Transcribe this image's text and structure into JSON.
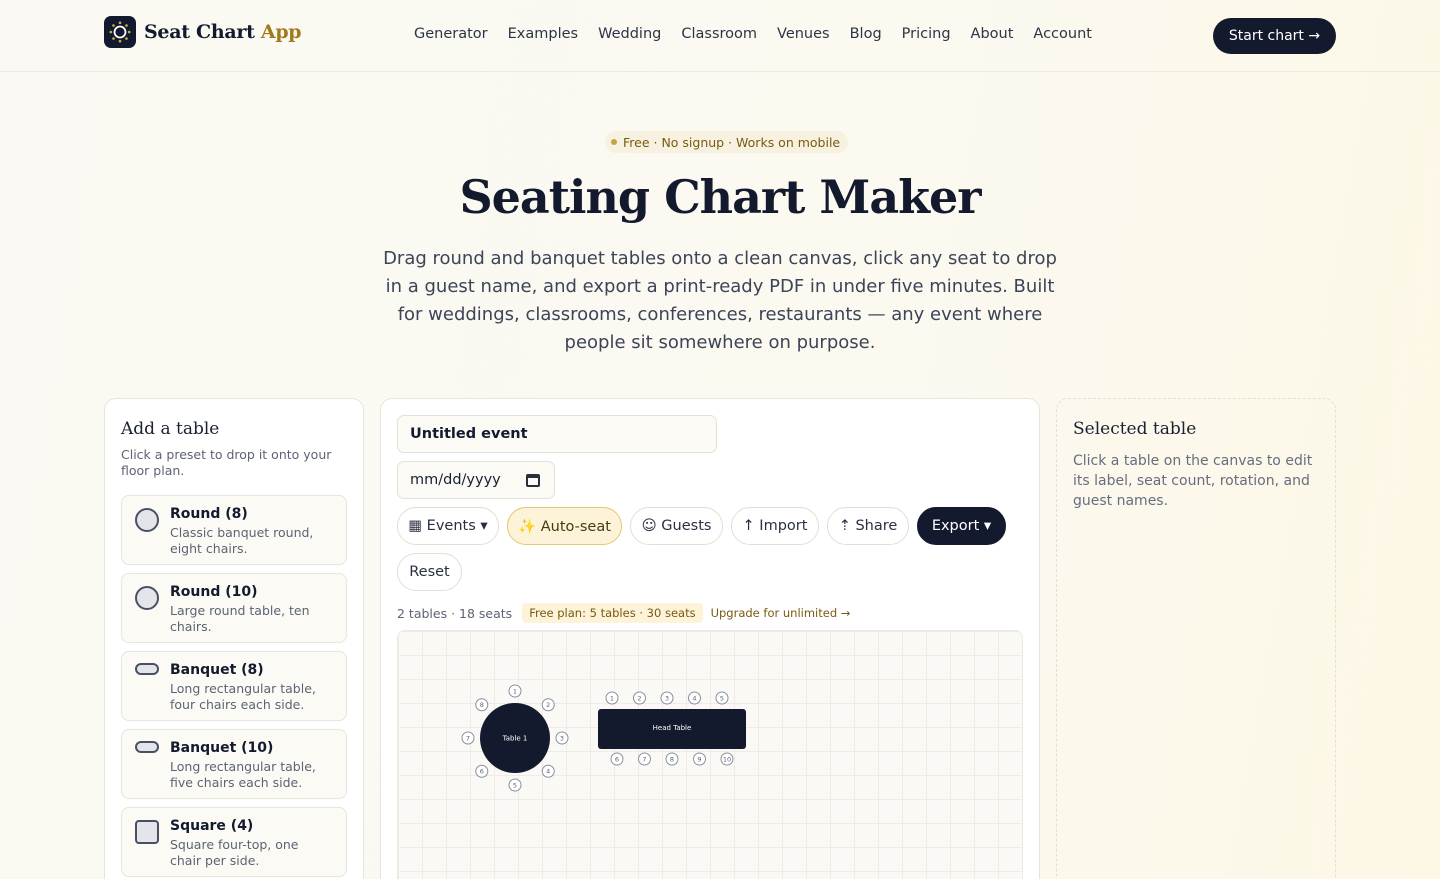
{
  "brand": {
    "name": "Seat Chart",
    "accent": "App"
  },
  "nav": [
    "Generator",
    "Examples",
    "Wedding",
    "Classroom",
    "Venues",
    "Blog",
    "Pricing",
    "About",
    "Account"
  ],
  "cta": "Start chart →",
  "hero": {
    "badge": "Free · No signup · Works on mobile",
    "title": "Seating Chart Maker",
    "subtitle": "Drag round and banquet tables onto a clean canvas, click any seat to drop in a guest name, and export a print-ready PDF in under five minutes. Built for weddings, classrooms, conferences, restaurants — any event where people sit somewhere on purpose."
  },
  "left_panel": {
    "title": "Add a table",
    "description": "Click a preset to drop it onto your floor plan.",
    "presets": [
      {
        "name": "Round (8)",
        "description": "Classic banquet round, eight chairs.",
        "shape": "round"
      },
      {
        "name": "Round (10)",
        "description": "Large round table, ten chairs.",
        "shape": "round"
      },
      {
        "name": "Banquet (8)",
        "description": "Long rectangular table, four chairs each side.",
        "shape": "banquet"
      },
      {
        "name": "Banquet (10)",
        "description": "Long rectangular table, five chairs each side.",
        "shape": "banquet"
      },
      {
        "name": "Square (4)",
        "description": "Square four-top, one chair per side.",
        "shape": "square"
      }
    ]
  },
  "editor": {
    "event_name": "Untitled event",
    "date_placeholder": "mm/dd/yyyy",
    "buttons": {
      "events": "▦ Events ▾",
      "autoseat": "✨ Auto-seat",
      "guests": "☺ Guests",
      "import": "↑ Import",
      "share": "⇡ Share",
      "export": "Export ▾",
      "reset": "Reset"
    },
    "stats": "2 tables · 18 seats",
    "plan": "Free plan: 5 tables · 30 seats",
    "upgrade": "Upgrade for unlimited →",
    "tables": [
      {
        "label": "Table 1",
        "type": "round",
        "seats": [
          "1",
          "2",
          "3",
          "4",
          "5",
          "6",
          "7",
          "8"
        ]
      },
      {
        "label": "Head Table",
        "type": "banquet",
        "seats": [
          "1",
          "2",
          "3",
          "4",
          "5",
          "6",
          "7",
          "8",
          "9",
          "10"
        ]
      }
    ]
  },
  "right_panel": {
    "title": "Selected table",
    "description": "Click a table on the canvas to edit its label, seat count, rotation, and guest names."
  },
  "colors": {
    "navy": "#141a2e",
    "gold": "#a07a1c",
    "cream": "#faf9f3"
  }
}
